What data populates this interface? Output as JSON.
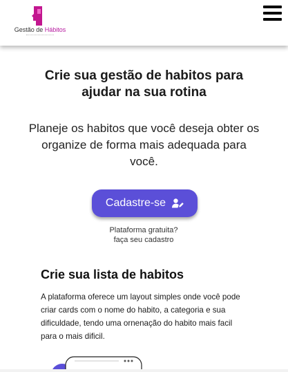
{
  "header": {
    "logo": {
      "text_main": "Gestão de",
      "text_accent": "Hábitos",
      "icon": "head-profile-logo-icon",
      "accent_color": "#b5179e"
    },
    "menu_icon": "hamburger-menu-icon"
  },
  "hero": {
    "title": "Crie sua gestão de habitos para ajudar na sua rotina",
    "description": "Planeje os habitos que você deseja obter os organize de forma mais adequada para você."
  },
  "cta": {
    "label": "Cadastre-se",
    "icon": "user-edit-icon",
    "color": "#5b4fd8",
    "note_line1": "Plataforma gratuita?",
    "note_line2": "faça seu cadastro"
  },
  "section": {
    "title": "Crie sua lista de habitos",
    "text": "A plataforma oferece um layout simples onde você pode criar cards com o nome do habito, a categoria e sua dificuldade, tendo uma ornenação do habito mais facil para o mais dificil."
  }
}
